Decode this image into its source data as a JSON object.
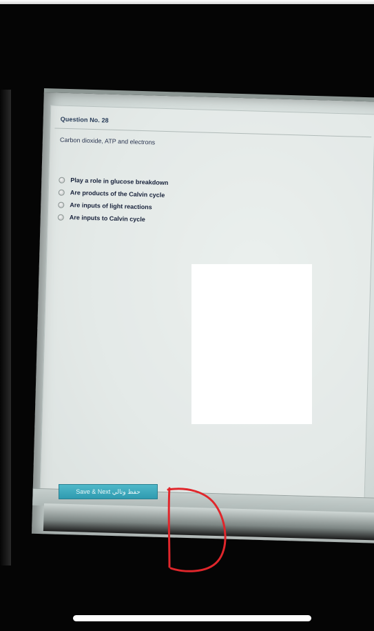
{
  "question": {
    "header": "Question No. 28",
    "text": "Carbon dioxide, ATP and electrons",
    "options": [
      {
        "label": "Play a role in glucose breakdown"
      },
      {
        "label": "Are products of the Calvin cycle"
      },
      {
        "label": "Are inputs of light reactions"
      },
      {
        "label": "Are inputs to Calvin cycle"
      }
    ]
  },
  "footer": {
    "save_next_label": "Save & Next حفظ وتالي"
  },
  "annotation": {
    "letter": "D",
    "color": "#e0262b"
  }
}
